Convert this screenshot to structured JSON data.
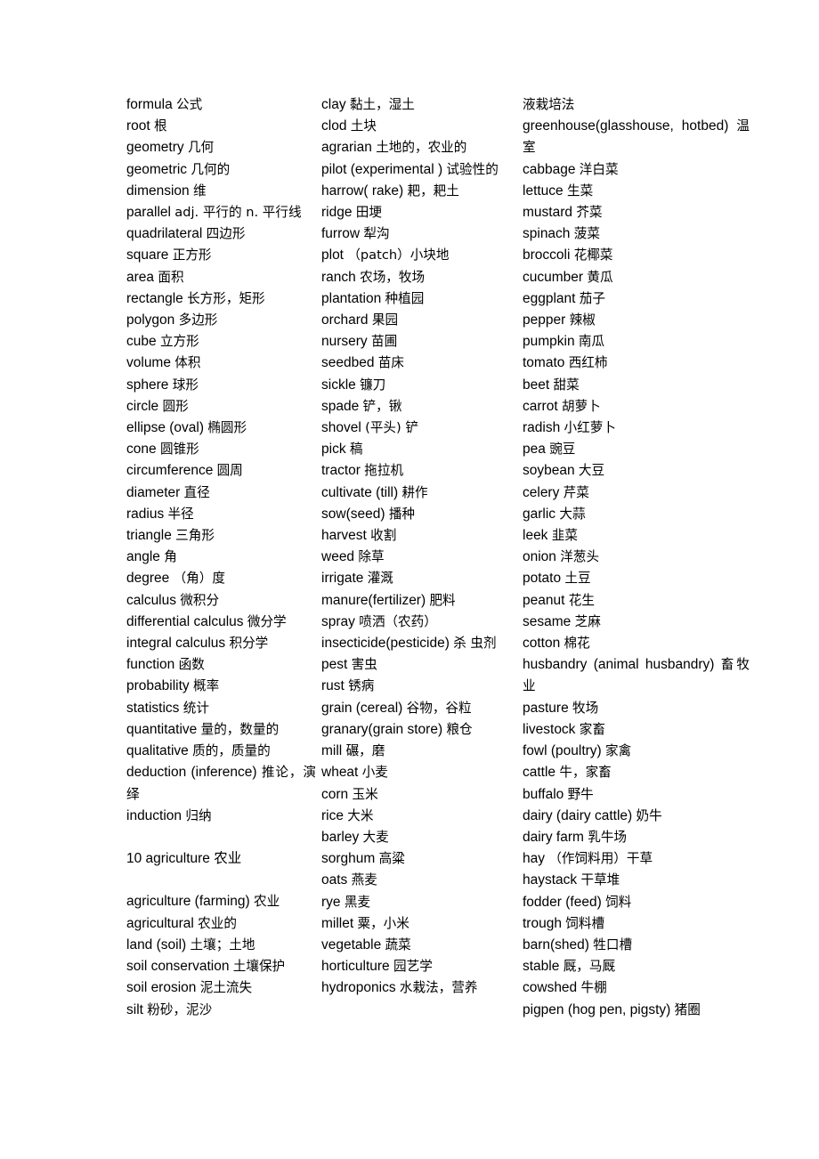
{
  "document": {
    "type": "bilingual-vocabulary-glossary",
    "language_pair": "English-Chinese",
    "page_background": "#ffffff",
    "text_color": "#000000"
  },
  "columns": [
    {
      "id": "column-1",
      "topic": "mathematics-geometry",
      "entries": [
        {
          "en": "formula",
          "zh": "公式"
        },
        {
          "en": "root",
          "zh": "根"
        },
        {
          "en": "geometry",
          "zh": "几何"
        },
        {
          "en": "geometric",
          "zh": "几何的"
        },
        {
          "en": "dimension",
          "zh": "维"
        },
        {
          "en": "parallel",
          "zh": "adj. 平行的 n. 平行线",
          "wraps": true
        },
        {
          "en": "quadrilateral",
          "zh": "四边形"
        },
        {
          "en": "square",
          "zh": "正方形"
        },
        {
          "en": "area",
          "zh": "面积"
        },
        {
          "en": "rectangle",
          "zh": "长方形，矩形"
        },
        {
          "en": "polygon",
          "zh": "多边形"
        },
        {
          "en": "cube",
          "zh": "立方形"
        },
        {
          "en": "volume",
          "zh": "体积"
        },
        {
          "en": "sphere",
          "zh": "球形"
        },
        {
          "en": "circle",
          "zh": "圆形"
        },
        {
          "en": "ellipse (oval)",
          "zh": "椭圆形"
        },
        {
          "en": "cone",
          "zh": "圆锥形"
        },
        {
          "en": "circumference",
          "zh": "圆周"
        },
        {
          "en": "diameter",
          "zh": "直径"
        },
        {
          "en": "radius",
          "zh": "半径"
        },
        {
          "en": "triangle",
          "zh": "三角形"
        },
        {
          "en": "angle",
          "zh": "角"
        },
        {
          "en": "degree",
          "zh": "（角）度"
        },
        {
          "en": "calculus",
          "zh": "微积分"
        },
        {
          "en": "differential calculus",
          "zh": "微分学"
        },
        {
          "en": "integral calculus",
          "zh": "积分学"
        },
        {
          "en": "function",
          "zh": "函数"
        },
        {
          "en": "probability",
          "zh": "概率"
        },
        {
          "en": "statistics",
          "zh": "统计"
        },
        {
          "en": "quantitative",
          "zh": "量的，数量的"
        },
        {
          "en": "qualitative",
          "zh": "质的，质量的"
        },
        {
          "en": "deduction (inference)",
          "zh": "推论，演绎",
          "wraps": true
        },
        {
          "en": "induction",
          "zh": "归纳"
        }
      ],
      "section_heading": "10 agriculture  农业",
      "entries_after_heading": [
        {
          "en": "agriculture (farming)",
          "zh": "农业"
        },
        {
          "en": "agricultural",
          "zh": "农业的"
        },
        {
          "en": "land (soil)",
          "zh": "土壤；土地"
        },
        {
          "en": "soil conservation",
          "zh": "土壤保护"
        },
        {
          "en": "soil erosion",
          "zh": "泥土流失"
        },
        {
          "en": "silt",
          "zh": "粉砂，泥沙"
        }
      ]
    },
    {
      "id": "column-2",
      "topic": "agriculture-soil-tools-crops",
      "entries": [
        {
          "en": "clay",
          "zh": "黏土，湿土"
        },
        {
          "en": "clod",
          "zh": "土块"
        },
        {
          "en": "agrarian",
          "zh": "土地的，农业的"
        },
        {
          "en": "pilot (experimental )",
          "zh": "试验性的",
          "wraps": true,
          "justified": true
        },
        {
          "en": "harrow( rake)",
          "zh": "耙，耙土"
        },
        {
          "en": "ridge",
          "zh": "田埂"
        },
        {
          "en": "furrow",
          "zh": "犁沟"
        },
        {
          "en": "plot",
          "zh": "（patch）小块地"
        },
        {
          "en": "ranch",
          "zh": "农场，牧场"
        },
        {
          "en": "plantation",
          "zh": "种植园"
        },
        {
          "en": "orchard",
          "zh": "果园"
        },
        {
          "en": "nursery",
          "zh": "苗圃"
        },
        {
          "en": "seedbed",
          "zh": "苗床"
        },
        {
          "en": "sickle",
          "zh": "镰刀"
        },
        {
          "en": "spade",
          "zh": "铲，锹"
        },
        {
          "en": "shovel",
          "zh": "(平头) 铲"
        },
        {
          "en": "pick",
          "zh": "稿"
        },
        {
          "en": "tractor",
          "zh": "拖拉机"
        },
        {
          "en": "cultivate (till)",
          "zh": "耕作"
        },
        {
          "en": "sow(seed)",
          "zh": "播种"
        },
        {
          "en": "harvest",
          "zh": "收割"
        },
        {
          "en": "weed",
          "zh": "除草"
        },
        {
          "en": "irrigate",
          "zh": "灌溉"
        },
        {
          "en": "manure(fertilizer)",
          "zh": "肥料"
        },
        {
          "en": "spray",
          "zh": "喷洒（农药）"
        },
        {
          "en": "insecticide(pesticide)",
          "zh": "杀 虫剂",
          "wraps": true,
          "justified": true
        },
        {
          "en": "pest",
          "zh": "害虫"
        },
        {
          "en": "rust",
          "zh": "锈病"
        },
        {
          "en": "grain (cereal)",
          "zh": "谷物，谷粒"
        },
        {
          "en": "granary(grain store)",
          "zh": "粮仓"
        },
        {
          "en": "mill",
          "zh": "碾，磨"
        },
        {
          "en": "wheat",
          "zh": "小麦"
        },
        {
          "en": "corn",
          "zh": "玉米"
        },
        {
          "en": "rice",
          "zh": "大米"
        },
        {
          "en": "barley",
          "zh": "大麦"
        },
        {
          "en": "sorghum",
          "zh": "高粱"
        },
        {
          "en": "oats",
          "zh": "燕麦"
        },
        {
          "en": "rye",
          "zh": "黑麦"
        },
        {
          "en": "millet",
          "zh": "粟，小米"
        },
        {
          "en": "vegetable",
          "zh": "蔬菜"
        },
        {
          "en": "horticulture",
          "zh": "园艺学"
        },
        {
          "en": "hydroponics",
          "zh": "水栽法，营养",
          "continues_in_next_column": true
        }
      ]
    },
    {
      "id": "column-3",
      "topic": "vegetables-livestock",
      "continuation_line": "液栽培法",
      "entries": [
        {
          "en": "greenhouse(glasshouse, hotbed)",
          "zh": "温室",
          "wraps": true
        },
        {
          "en": "cabbage",
          "zh": "洋白菜"
        },
        {
          "en": "lettuce",
          "zh": "生菜"
        },
        {
          "en": "mustard",
          "zh": "芥菜"
        },
        {
          "en": "spinach",
          "zh": "菠菜"
        },
        {
          "en": "broccoli",
          "zh": "花椰菜"
        },
        {
          "en": "cucumber",
          "zh": "黄瓜"
        },
        {
          "en": "eggplant",
          "zh": "茄子"
        },
        {
          "en": "pepper",
          "zh": "辣椒"
        },
        {
          "en": "pumpkin",
          "zh": "南瓜"
        },
        {
          "en": "tomato",
          "zh": "西红柿"
        },
        {
          "en": "beet",
          "zh": "甜菜"
        },
        {
          "en": "carrot",
          "zh": "胡萝卜"
        },
        {
          "en": "radish",
          "zh": "小红萝卜"
        },
        {
          "en": "pea",
          "zh": "豌豆"
        },
        {
          "en": "soybean",
          "zh": "大豆"
        },
        {
          "en": "celery",
          "zh": "芹菜"
        },
        {
          "en": "garlic",
          "zh": "大蒜"
        },
        {
          "en": "leek",
          "zh": "韭菜"
        },
        {
          "en": "onion",
          "zh": "洋葱头"
        },
        {
          "en": "potato",
          "zh": "土豆"
        },
        {
          "en": "peanut",
          "zh": "花生"
        },
        {
          "en": "sesame",
          "zh": "芝麻"
        },
        {
          "en": "cotton",
          "zh": "棉花"
        },
        {
          "en": "husbandry (animal husbandry)",
          "zh": "畜牧业",
          "wraps": true,
          "justified": true
        },
        {
          "en": "pasture",
          "zh": "牧场"
        },
        {
          "en": "livestock",
          "zh": "家畜"
        },
        {
          "en": "fowl (poultry)",
          "zh": "家禽"
        },
        {
          "en": "cattle",
          "zh": "牛，家畜"
        },
        {
          "en": "buffalo",
          "zh": "野牛"
        },
        {
          "en": "dairy (dairy cattle)",
          "zh": "奶牛"
        },
        {
          "en": "dairy farm",
          "zh": "乳牛场"
        },
        {
          "en": "hay",
          "zh": "（作饲料用）干草"
        },
        {
          "en": "haystack",
          "zh": "干草堆"
        },
        {
          "en": "fodder (feed)",
          "zh": "饲料"
        },
        {
          "en": "trough",
          "zh": "饲料槽"
        },
        {
          "en": "barn(shed)",
          "zh": "牲口槽"
        },
        {
          "en": "stable",
          "zh": "厩，马厩"
        },
        {
          "en": "cowshed",
          "zh": "牛棚"
        },
        {
          "en": "pigpen (hog pen, pigsty)",
          "zh": "猪圈",
          "wraps": true,
          "justified": true
        }
      ]
    }
  ]
}
